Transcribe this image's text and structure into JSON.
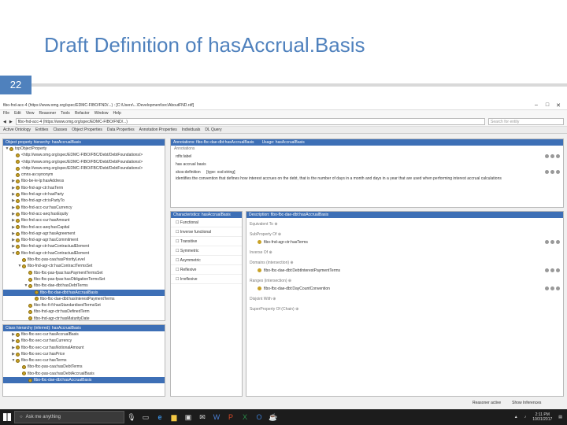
{
  "slide": {
    "title": "Draft Definition of hasAccrual.Basis",
    "number": "22"
  },
  "window": {
    "title": "fibo-fnd-acc-4 (https://www.omg.org/spec/EDMC-FIBO/FND/...) : [C:\\Users\\...\\Development\\src\\AboutFND.rdf]",
    "menus": [
      "File",
      "Edit",
      "View",
      "Reasoner",
      "Tools",
      "Refactor",
      "Window",
      "Help"
    ],
    "address": "fibo-fnd-acc-4 (https://www.omg.org/spec/EDMC-FIBO/FND/...)",
    "search_placeholder": "Search for entity",
    "tabs": [
      "Active Ontology",
      "Entities",
      "Classes",
      "Object Properties",
      "Data Properties",
      "Annotation Properties",
      "Individuals",
      "DL Query"
    ]
  },
  "left_tree": {
    "header": "Object property hierarchy: hasAccrualBasis",
    "items": [
      {
        "label": "topObjectProperty",
        "exp": "▼"
      },
      {
        "label": "<http://www.omg.org/spec/EDMC-FIBO/FBC/Debt/DebtFoundations/>",
        "exp": ""
      },
      {
        "label": "<http://www.omg.org/spec/EDMC-FIBO/FBC/Debt/DebtFoundations/>",
        "exp": ""
      },
      {
        "label": "<http://www.omg.org/spec/EDMC-FIBO/FBC/Debt/DebtFoundations/>",
        "exp": ""
      },
      {
        "label": "cmns-av:synonym",
        "exp": ""
      },
      {
        "label": "fibo-be-le-lp:hasAddress",
        "exp": "▶"
      },
      {
        "label": "fibo-fnd-agr-ctr:hasTerm",
        "exp": "▶"
      },
      {
        "label": "fibo-fnd-agr-ctr:hasParty",
        "exp": "▶"
      },
      {
        "label": "fibo-fnd-agr-ctr:isPartyTo",
        "exp": "▶"
      },
      {
        "label": "fibo-fnd-acc-cur:hasCurrency",
        "exp": "▶"
      },
      {
        "label": "fibo-fnd-acc-aeq:hasEquity",
        "exp": "▶"
      },
      {
        "label": "fibo-fnd-acc-cur:hasAmount",
        "exp": "▶"
      },
      {
        "label": "fibo-fnd-acc-aeq:hasCapital",
        "exp": "▶"
      },
      {
        "label": "fibo-fnd-agr-agr:hasAgreement",
        "exp": "▶"
      },
      {
        "label": "fibo-fnd-agr-agr:hasCommitment",
        "exp": "▶"
      },
      {
        "label": "fibo-fnd-agr-ctr:hasContractualElement",
        "exp": "▶"
      },
      {
        "label": "fibo-fnd-agr-ctr:hasContractualElement",
        "exp": "▼"
      },
      {
        "label": "fibo-fbc-pas-caa:hasPriorityLevel",
        "exp": ""
      },
      {
        "label": "fibo-fnd-agr-ctr:hasContractTermsSet",
        "exp": "▼"
      },
      {
        "label": "fibo-fbc-pas-fpas:hasPaymentTermsSet",
        "exp": ""
      },
      {
        "label": "fibo-fbc-pas-fpas:hasObligationTermsSet",
        "exp": ""
      },
      {
        "label": "fibo-fbc-dae-dbt:hasDebtTerms",
        "exp": "▼"
      },
      {
        "label": "fibo-fbc-dae-dbt:hasAccrualBasis",
        "exp": "",
        "sel": true
      },
      {
        "label": "fibo-fbc-dae-dbt:hasInterestPaymentTerms",
        "exp": ""
      },
      {
        "label": "fibo-fbc-fi-fi:hasStandardisedTermsSet",
        "exp": ""
      },
      {
        "label": "fibo-fnd-agr-ctr:hasDefinedTerm",
        "exp": ""
      },
      {
        "label": "fibo-fnd-agr-ctr:hasMaturityDate",
        "exp": ""
      },
      {
        "label": "fibo-fnd-agr-ctr:hasRequiredTermsSet",
        "exp": ""
      },
      {
        "label": "fibo-fbc-pas-fpas:hasConversionTerms",
        "exp": ""
      },
      {
        "label": "fibo-fnd-agr-ctr:hasContractualRestriction",
        "exp": ""
      }
    ]
  },
  "left_bottom": {
    "header": "Class hierarchy (inferred): hasAccrualBasis",
    "items": [
      {
        "label": "fibo-fbc-sec-cur:hasAccrualBasis",
        "exp": "▶"
      },
      {
        "label": "fibo-fbc-sec-cur:hasCurrency",
        "exp": "▶"
      },
      {
        "label": "fibo-fbc-sec-cur:hasNotionalAmount",
        "exp": "▶"
      },
      {
        "label": "fibo-fbc-sec-cur:hasPrice",
        "exp": "▶"
      },
      {
        "label": "fibo-fbc-sec-cur:hasTerms",
        "exp": "▼"
      },
      {
        "label": "fibo-fbc-pas-caa:hasDebtTerms",
        "exp": ""
      },
      {
        "label": "fibo-fbc-pas-caa:hasDebtAccrualBasis",
        "exp": ""
      },
      {
        "label": "fibo-fbc-dae-dbt:hasAccrualBasis",
        "exp": "",
        "sel": true
      }
    ]
  },
  "annotations": {
    "header": "Annotations: fibo-fbc-dae-dbt:hasAccrualBasis",
    "tab2": "Usage: hasAccrualBasis",
    "section": "Annotations",
    "rows": [
      {
        "key": "rdfs:label",
        "value": ""
      },
      {
        "key": "",
        "value": "has accrual basis"
      },
      {
        "key": "skos:definition",
        "value": "[type: xsd:string]"
      },
      {
        "key": "",
        "value": "identifies the convention that defines how interest accrues on the debt, that is the number of days in a month and days in a year that are used when performing interest accrual calculations"
      }
    ]
  },
  "characteristics": {
    "header": "Characteristics: hasAccrualBasis",
    "items": [
      "Functional",
      "Inverse functional",
      "Transitive",
      "Symmetric",
      "Asymmetric",
      "Reflexive",
      "Irreflexive"
    ]
  },
  "description": {
    "header": "Description: fibo-fbc-dae-dbt:hasAccrualBasis",
    "sections": [
      {
        "title": "Equivalent To",
        "value": ""
      },
      {
        "title": "SubProperty Of",
        "value": "fibo-fnd-agr-ctr:hasTerms"
      },
      {
        "title": "Inverse Of",
        "value": ""
      },
      {
        "title": "Domains (intersection)",
        "value": "fibo-fbc-dae-dbt:DebtInterestPaymentTerms"
      },
      {
        "title": "Ranges (intersection)",
        "value": "fibo-fbc-dae-dbt:DayCountConvention"
      },
      {
        "title": "Disjoint With",
        "value": ""
      },
      {
        "title": "SuperProperty Of (Chain)",
        "value": ""
      }
    ]
  },
  "statusbar": {
    "reasoner": "Reasoner active",
    "show_inferences": "Show Inferences"
  },
  "taskbar": {
    "search": "Ask me anything",
    "time": "2:11 PM",
    "date": "10/31/2017"
  },
  "colors": {
    "accent": "#4f81bd",
    "selection": "#3d6fb6",
    "entity": "#c9a227"
  }
}
